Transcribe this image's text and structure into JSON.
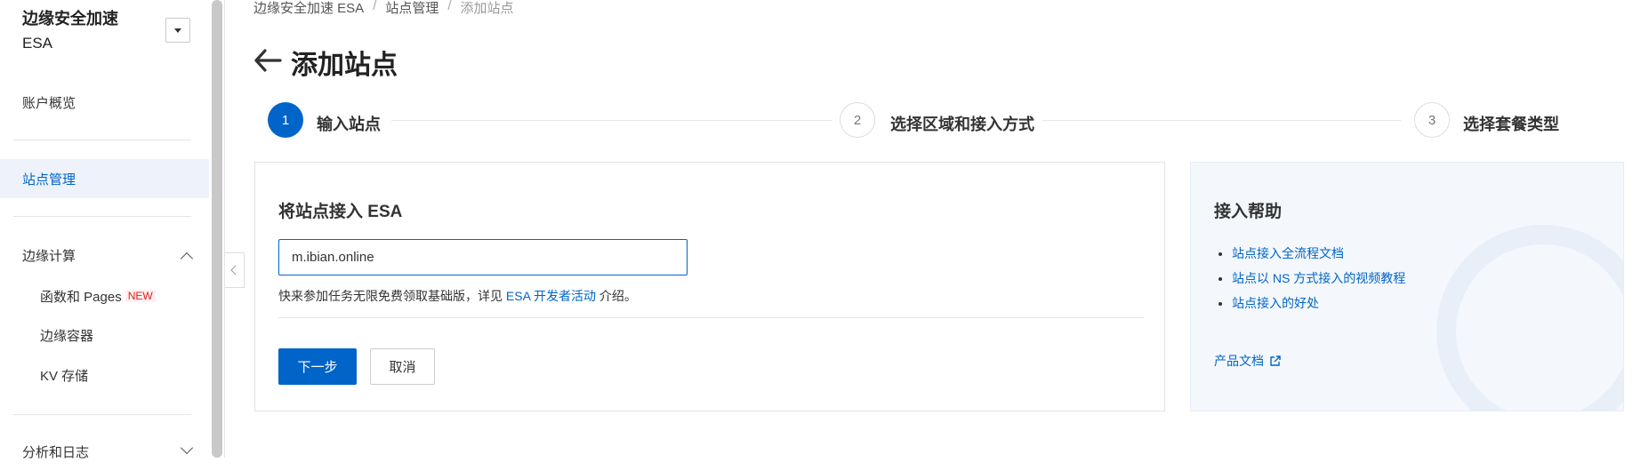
{
  "sidebar": {
    "brand_line1": "边缘安全加速",
    "brand_line2": "ESA",
    "items": {
      "overview": "账户概览",
      "site_mgmt": "站点管理",
      "edge_compute": "边缘计算",
      "functions": "函数和 Pages",
      "new_badge": "NEW",
      "containers": "边缘容器",
      "kv": "KV 存储",
      "analytics": "分析和日志"
    }
  },
  "breadcrumb": {
    "root": "边缘安全加速 ESA",
    "sep": "/",
    "parent": "站点管理",
    "current": "添加站点"
  },
  "page_title": "添加站点",
  "steps": [
    {
      "num": "1",
      "label": "输入站点"
    },
    {
      "num": "2",
      "label": "选择区域和接入方式"
    },
    {
      "num": "3",
      "label": "选择套餐类型"
    }
  ],
  "form": {
    "title": "将站点接入 ESA",
    "site_value": "m.ibian.online",
    "hint_prefix": "快来参加任务无限免费领取基础版，详见",
    "hint_link": "ESA 开发者活动",
    "hint_suffix": "介绍。",
    "next_label": "下一步",
    "cancel_label": "取消"
  },
  "help": {
    "title": "接入帮助",
    "links": [
      "站点接入全流程文档",
      "站点以 NS 方式接入的视频教程",
      "站点接入的好处"
    ],
    "doc_label": "产品文档"
  },
  "colors": {
    "accent": "#0064c8",
    "active_bg": "#eef3fb",
    "help_bg": "#f4f8fd"
  }
}
